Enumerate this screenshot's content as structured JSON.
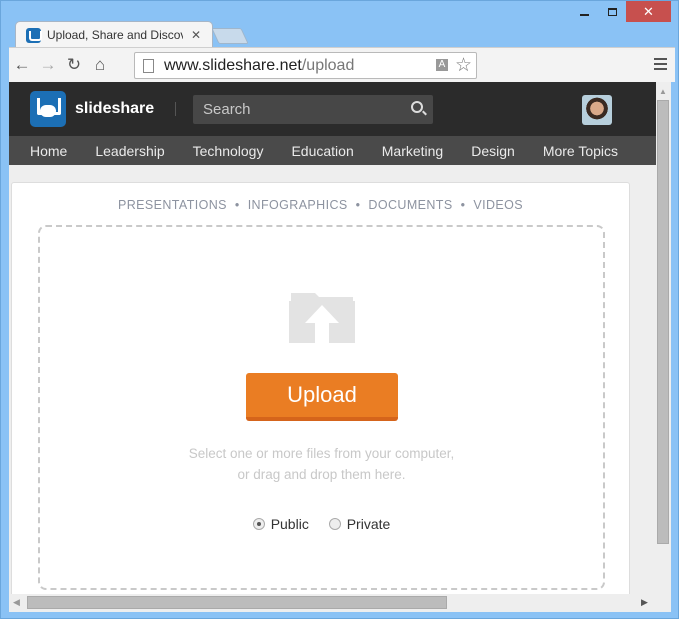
{
  "window": {
    "minimize_icon": "minimize-icon",
    "maximize_icon": "maximize-icon",
    "close_glyph": "✕"
  },
  "tab": {
    "title": "Upload, Share and Discover",
    "close_glyph": "✕",
    "favicon": "slideshare-favicon"
  },
  "toolbar": {
    "back_glyph": "←",
    "forward_glyph": "→",
    "reload_glyph": "↻",
    "home_glyph": "⌂",
    "url_host": "www.slideshare.net",
    "url_path": "/upload",
    "translate_glyph": "A",
    "star_glyph": "☆"
  },
  "header": {
    "brand": "slideshare",
    "search_placeholder": "Search"
  },
  "topics": [
    "Home",
    "Leadership",
    "Technology",
    "Education",
    "Marketing",
    "Design",
    "More Topics"
  ],
  "upload": {
    "types": [
      "PRESENTATIONS",
      "INFOGRAPHICS",
      "DOCUMENTS",
      "VIDEOS"
    ],
    "separator": "•",
    "button_label": "Upload",
    "hint_line1": "Select one or more files from your computer,",
    "hint_line2": "or drag and drop them here.",
    "privacy_options": [
      {
        "label": "Public",
        "selected": true
      },
      {
        "label": "Private",
        "selected": false
      }
    ]
  },
  "colors": {
    "accent": "#ea7d23",
    "brand": "#1c6fb5",
    "header_bg": "#2b2b2b",
    "topics_bg": "#4a4a4a"
  },
  "scroll": {
    "up_glyph": "▲",
    "left_glyph": "◀",
    "right_glyph": "▶"
  }
}
